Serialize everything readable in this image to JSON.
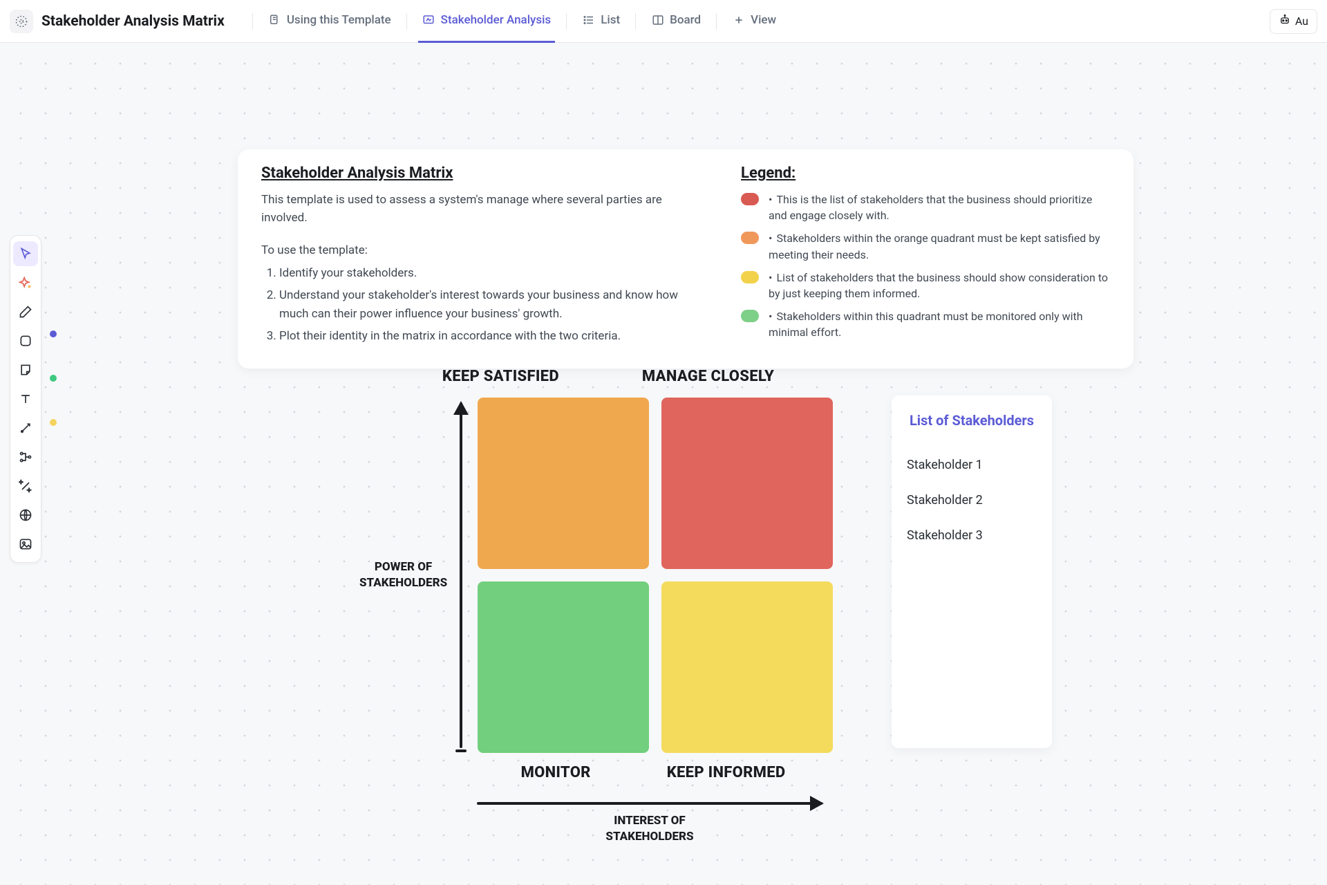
{
  "header": {
    "title": "Stakeholder Analysis Matrix",
    "tabs": [
      {
        "label": "Using this Template",
        "active": false
      },
      {
        "label": "Stakeholder Analysis",
        "active": true
      },
      {
        "label": "List",
        "active": false
      },
      {
        "label": "Board",
        "active": false
      }
    ],
    "add_view_label": "View",
    "ai_button": "Au"
  },
  "info": {
    "title": "Stakeholder Analysis Matrix",
    "desc": "This template is used to assess a system's manage where several parties are involved.",
    "sub": "To use the template:",
    "steps": [
      "Identify your stakeholders.",
      "Understand your stakeholder's interest towards your business and know how much can their power influence your business' growth.",
      "Plot their identity in the matrix in accordance with the two criteria."
    ]
  },
  "legend": {
    "title": "Legend:",
    "items": [
      {
        "color": "#d85a52",
        "text": "This is the list of stakeholders that the business should prioritize and engage closely with."
      },
      {
        "color": "#f0985a",
        "text": "Stakeholders within the orange quadrant must be kept satisfied by meeting their needs."
      },
      {
        "color": "#f2d24a",
        "text": "List of stakeholders that the business should show consideration to by just keeping them informed."
      },
      {
        "color": "#7ed088",
        "text": "Stakeholders within this quadrant must be monitored only with minimal effort."
      }
    ]
  },
  "matrix": {
    "top_labels": [
      "KEEP SATISFIED",
      "MANAGE CLOSELY"
    ],
    "bottom_labels": [
      "MONITOR",
      "KEEP INFORMED"
    ],
    "y_axis": "POWER OF\nSTAKEHOLDERS",
    "x_axis": "INTEREST OF\nSTAKEHOLDERS",
    "colors": {
      "top_left": "#f0a84e",
      "top_right": "#e0655c",
      "bottom_left": "#72cf7d",
      "bottom_right": "#f4db5c"
    }
  },
  "stakeholders": {
    "title": "List of Stakeholders",
    "items": [
      "Stakeholder 1",
      "Stakeholder 2",
      "Stakeholder 3"
    ]
  },
  "toolbar_dots": [
    "#5b5bd6",
    "#3ec97e",
    "#f4d35e"
  ]
}
